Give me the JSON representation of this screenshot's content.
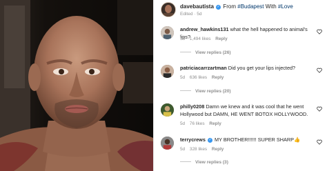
{
  "post": {
    "username": "davebautista",
    "caption_prefix": "From ",
    "hashtag_1": "#Budapest",
    "caption_middle": " With ",
    "hashtag_2": "#Love",
    "edited_label": "Edited · 5d"
  },
  "comments": [
    {
      "username": "andrew_hawkins131",
      "text": "what the hell happened to animal's lips?",
      "age": "5d",
      "likes": "1,494 likes",
      "reply_label": "Reply",
      "view_replies": "View replies (26)"
    },
    {
      "username": "patriciacarrzartman",
      "text": "Did you get your lips injected?",
      "age": "5d",
      "likes": "636 likes",
      "reply_label": "Reply",
      "view_replies": "View replies (20)"
    },
    {
      "username": "philly0208",
      "text": "Damn we knew and it was cool that he went Hollywood but DAMN, HE WENT BOTOX HOLLYWOOD.",
      "age": "5d",
      "likes": "76 likes",
      "reply_label": "Reply"
    },
    {
      "username": "terrycrews",
      "text": "MY BROTHER!!!!!! SUPER SHARP👍",
      "age": "5d",
      "likes": "328 likes",
      "reply_label": "Reply",
      "view_replies": "View replies (3)"
    }
  ],
  "icons": {
    "verified": "verified-badge-icon",
    "heart": "heart-icon"
  },
  "colors": {
    "link": "#00376b",
    "muted": "#8e8e8e",
    "verified": "#3897f0"
  }
}
